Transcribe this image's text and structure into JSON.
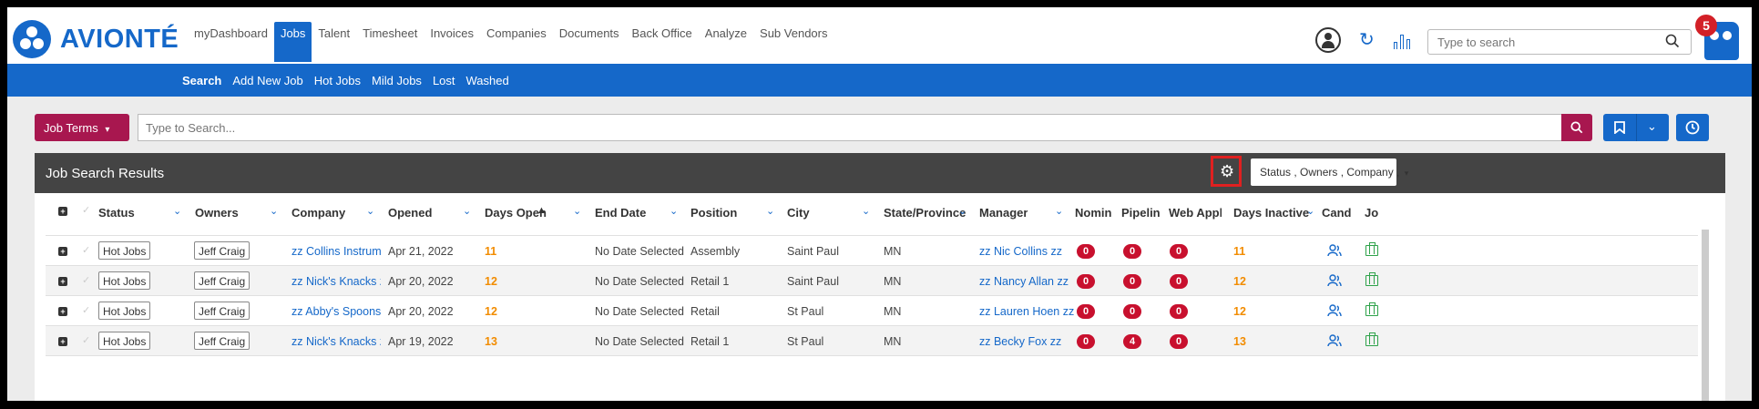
{
  "brand": {
    "name": "AVIONTÉ",
    "accent": "#1568c9",
    "secondary": "#a8174f"
  },
  "main_nav": [
    "myDashboard",
    "Jobs",
    "Talent",
    "Timesheet",
    "Invoices",
    "Companies",
    "Documents",
    "Back Office",
    "Analyze",
    "Sub Vendors"
  ],
  "main_nav_active": "Jobs",
  "sub_nav": [
    "Search",
    "Add New Job",
    "Hot Jobs",
    "Mild Jobs",
    "Lost",
    "Washed"
  ],
  "sub_nav_active": "Search",
  "top_search": {
    "placeholder": "Type to search"
  },
  "notifications": {
    "count": "5"
  },
  "job_terms_label": "Job Terms",
  "main_search": {
    "placeholder": "Type to Search..."
  },
  "results": {
    "title": "Job Search Results",
    "filter_dropdown": "Status , Owners , Company ,"
  },
  "columns": [
    "Status",
    "Owners",
    "Company",
    "Opened",
    "Days Open",
    "End Date",
    "Position",
    "City",
    "State/Province",
    "Manager",
    "Nomin",
    "Pipelin",
    "Web Appli",
    "Days Inactive",
    "Cand",
    "Jo"
  ],
  "rows": [
    {
      "status": "Hot Jobs",
      "owner": "Jeff Craig",
      "company": "zz Collins Instrum...",
      "opened": "Apr 21, 2022",
      "days_open": "11",
      "end_date": "No Date Selected",
      "position": "Assembly",
      "city": "Saint Paul",
      "state": "MN",
      "manager": "zz Nic Collins zz",
      "nomin": "0",
      "pipeline": "0",
      "web": "0",
      "days_inactive": "11"
    },
    {
      "status": "Hot Jobs",
      "owner": "Jeff Craig",
      "company": "zz Nick's Knacks zz",
      "opened": "Apr 20, 2022",
      "days_open": "12",
      "end_date": "No Date Selected",
      "position": "Retail 1",
      "city": "Saint Paul",
      "state": "MN",
      "manager": "zz Nancy Allan zz",
      "nomin": "0",
      "pipeline": "0",
      "web": "0",
      "days_inactive": "12"
    },
    {
      "status": "Hot Jobs",
      "owner": "Jeff Craig",
      "company": "zz Abby's Spoons zz",
      "opened": "Apr 20, 2022",
      "days_open": "12",
      "end_date": "No Date Selected",
      "position": "Retail",
      "city": "St Paul",
      "state": "MN",
      "manager": "zz Lauren Hoen zz",
      "nomin": "0",
      "pipeline": "0",
      "web": "0",
      "days_inactive": "12"
    },
    {
      "status": "Hot Jobs",
      "owner": "Jeff Craig",
      "company": "zz Nick's Knacks zz",
      "opened": "Apr 19, 2022",
      "days_open": "13",
      "end_date": "No Date Selected",
      "position": "Retail 1",
      "city": "St Paul",
      "state": "MN",
      "manager": "zz Becky Fox zz",
      "nomin": "0",
      "pipeline": "4",
      "web": "0",
      "days_inactive": "13"
    }
  ]
}
